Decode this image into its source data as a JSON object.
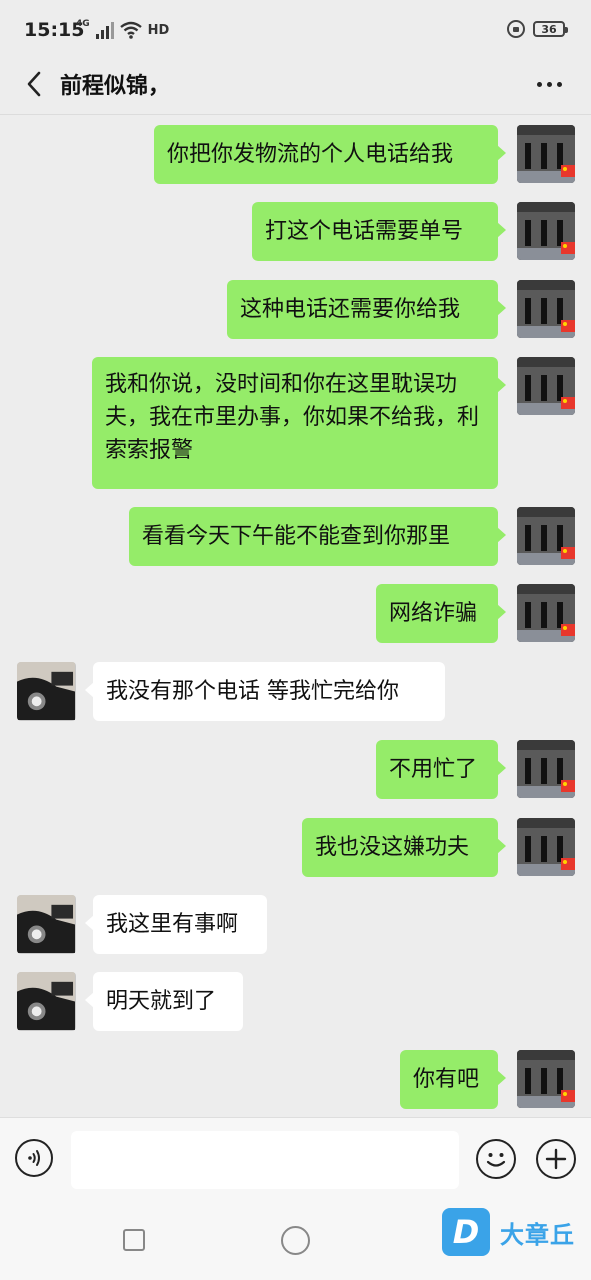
{
  "status_bar": {
    "time": "15:15",
    "network": "4G",
    "hd": "HD",
    "battery": "36"
  },
  "header": {
    "title": "前程似锦，"
  },
  "messages": [
    {
      "sender": "me",
      "text": "你把你发物流的个人电话给我"
    },
    {
      "sender": "me",
      "text": "打这个电话需要单号"
    },
    {
      "sender": "me",
      "text": "这种电话还需要你给我"
    },
    {
      "sender": "me",
      "text": "我和你说，没时间和你在这里耽误功夫，我在市里办事，你如果不给我，利索索报警"
    },
    {
      "sender": "me",
      "text": "看看今天下午能不能查到你那里"
    },
    {
      "sender": "me",
      "text": "网络诈骗"
    },
    {
      "sender": "them",
      "text": "我没有那个电话 等我忙完给你"
    },
    {
      "sender": "me",
      "text": "不用忙了"
    },
    {
      "sender": "me",
      "text": "我也没这嫌功夫"
    },
    {
      "sender": "them",
      "text": "我这里有事啊"
    },
    {
      "sender": "them",
      "text": "明天就到了"
    },
    {
      "sender": "me",
      "text": "你有吧"
    }
  ],
  "input_bar": {
    "placeholder": ""
  },
  "watermark": {
    "logo_letter": "D",
    "text": "大章丘"
  },
  "colors": {
    "my_bubble": "#95ec69",
    "their_bubble": "#ffffff",
    "background": "#ededed",
    "watermark": "#3aa3e8"
  }
}
